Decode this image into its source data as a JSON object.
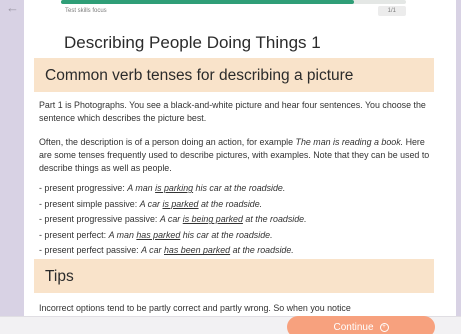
{
  "header": {
    "progress_label": "Test skills focus",
    "progress_count": "1/1",
    "progress_fraction": 0.85
  },
  "lesson": {
    "title": "Describing People Doing Things 1",
    "section1_heading": "Common verb tenses for describing a picture",
    "para1": "Part 1 is Photographs. You see a black-and-white picture and hear four sentences. You choose the sentence which describes the picture best.",
    "para2": {
      "before": "Often, the description is of a person doing an action, for example ",
      "example": "The man is reading a book.",
      "after": " Here are some tenses frequently used to describe pictures, with examples. Note that they can be used to describe things as well as people."
    },
    "examples": [
      {
        "label": "- present progressive: ",
        "pre": "A man ",
        "verb": "is parking",
        "post": " his car at the roadside."
      },
      {
        "label": "- present simple passive: ",
        "pre": "A car ",
        "verb": "is parked",
        "post": " at the roadside."
      },
      {
        "label": "- present progressive passive: ",
        "pre": "A car ",
        "verb": "is being parked",
        "post": " at the roadside."
      },
      {
        "label": "- present perfect: ",
        "pre": "A man ",
        "verb": "has parked",
        "post": " his car at the roadside."
      },
      {
        "label": "- present perfect passive: ",
        "pre": "A car ",
        "verb": "has been parked",
        "post": " at the roadside."
      }
    ],
    "section2_heading": "Tips",
    "tips_para": "Incorrect options tend to be partly correct and partly wrong. So when you notice"
  },
  "footer": {
    "continue_label": "Continue",
    "continue_icon": "+"
  },
  "icons": {
    "back": "←"
  }
}
